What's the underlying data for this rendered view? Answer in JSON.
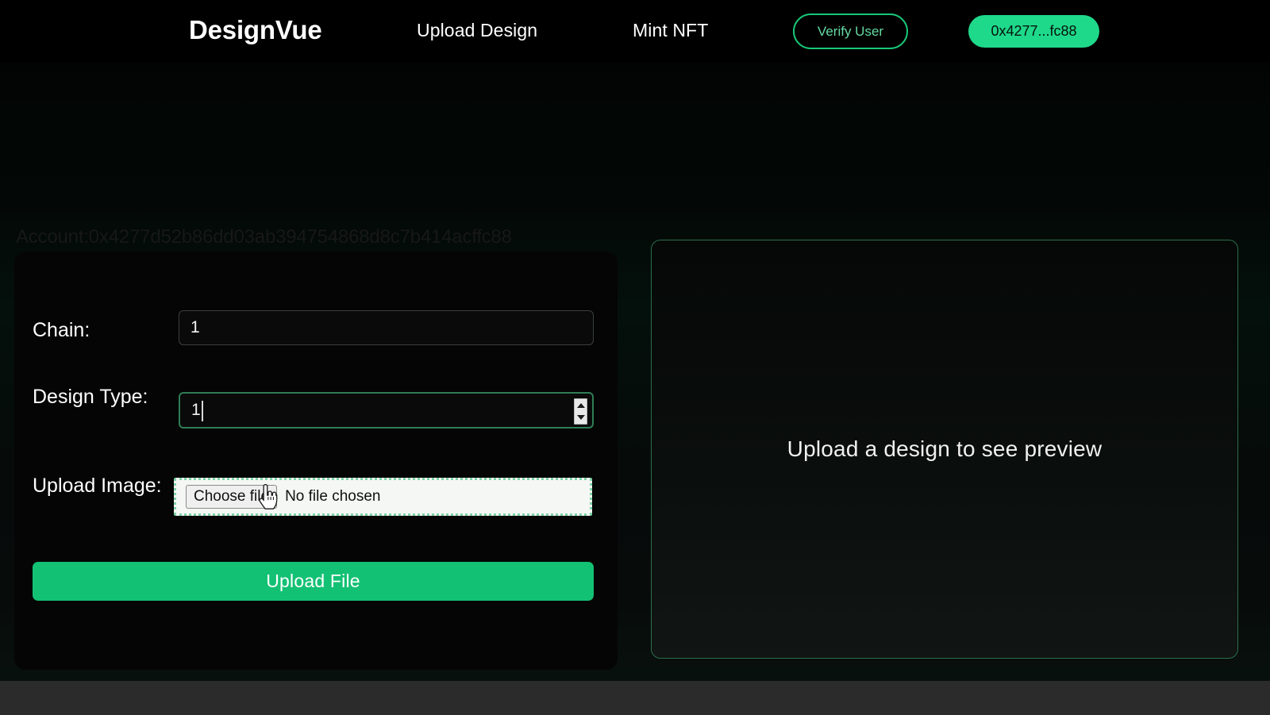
{
  "navbar": {
    "brand": "DesignVue",
    "links": [
      {
        "label": "Upload Design"
      },
      {
        "label": "Mint NFT"
      }
    ],
    "verify_button": "Verify User",
    "wallet_badge": "0x4277...fc88"
  },
  "account": {
    "text": "Account:0x4277d52b86dd03ab394754868d8c7b414acffc88"
  },
  "form": {
    "chain": {
      "label": "Chain:",
      "value": "1"
    },
    "design_type": {
      "label": "Design Type:",
      "value": "1"
    },
    "upload_image": {
      "label": "Upload Image:",
      "choose_button": "Choose file",
      "status": "No file chosen"
    },
    "submit_button": "Upload File"
  },
  "preview": {
    "placeholder": "Upload a design to see preview"
  },
  "colors": {
    "accent_green": "#1ed98a",
    "button_green": "#13c174",
    "outline_green": "#18c878",
    "verify_text": "#65d9a2",
    "panel_border": "#2d6e4c",
    "page_background": "#000000",
    "card_background": "#050505"
  }
}
